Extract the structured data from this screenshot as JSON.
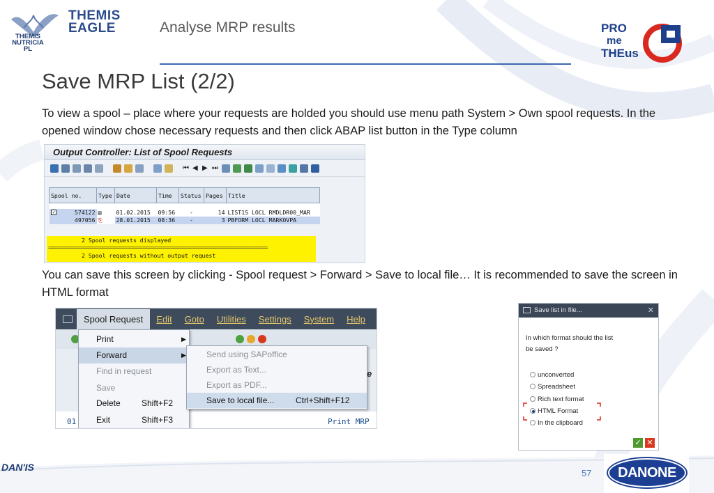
{
  "header": {
    "logo_line1": "THEMIS",
    "logo_line2": "NUTRICIA PL",
    "brand_line1": "THEMIS",
    "brand_line2": "EAGLE",
    "section_title": "Analyse MRP results",
    "prometheus": [
      "PRO",
      "me",
      "THEus"
    ]
  },
  "slide": {
    "title": "Save MRP List (2/2)",
    "paragraph1": "To view a spool – place where your requests are holded you should use menu path System > Own spool requests. In the opened window chose necessary requests and then click ABAP list button in the Type column",
    "paragraph2": "You can save this screen by clicking - Spool request > Forward > Save to local file… It is recommended to save the screen in HTML format"
  },
  "spool_screen": {
    "title": "Output Controller: List of Spool Requests",
    "columns": [
      "Spool no.",
      "Type",
      "Date",
      "Time",
      "Status",
      "Pages",
      "Title"
    ],
    "rows": [
      {
        "spool": "574122",
        "date": "01.02.2015",
        "time": "09:56",
        "status": "-",
        "pages": "14",
        "title": "LIST1S LOCL RMDLDR00_MAR"
      },
      {
        "spool": "497056",
        "date": "28.01.2015",
        "time": "08:36",
        "status": "-",
        "pages": "3",
        "title": "PBFORM LOCL MARKOVPA"
      }
    ],
    "status_line1": "2 Spool requests displayed",
    "status_line2": "2 Spool requests without output request"
  },
  "menu_screen": {
    "menubar": [
      "Spool Request",
      "Edit",
      "Goto",
      "Utilities",
      "Settings",
      "System",
      "Help"
    ],
    "dropdown": [
      {
        "label": "Print",
        "shortcut": "",
        "submenu": true,
        "disabled": false
      },
      {
        "label": "Forward",
        "shortcut": "",
        "submenu": true,
        "disabled": false
      },
      {
        "label": "Find in request",
        "shortcut": "",
        "submenu": false,
        "disabled": true
      },
      {
        "label": "Save",
        "shortcut": "",
        "submenu": false,
        "disabled": true
      },
      {
        "label": "Delete",
        "shortcut": "Shift+F2",
        "submenu": false,
        "disabled": false
      },
      {
        "label": "Exit",
        "shortcut": "Shift+F3",
        "submenu": false,
        "disabled": false
      }
    ],
    "submenu": [
      {
        "label": "Send using SAPoffice",
        "shortcut": "",
        "disabled": true
      },
      {
        "label": "Export as Text...",
        "shortcut": "",
        "disabled": true
      },
      {
        "label": "Export as PDF...",
        "shortcut": "",
        "disabled": true
      },
      {
        "label": "Save to local file...",
        "shortcut": "Ctrl+Shift+F12",
        "disabled": false
      }
    ],
    "bottom_left": "01",
    "bottom_right": "Print MRP"
  },
  "dialog": {
    "title": "Save list in file...",
    "question_line1": "In which format should the list",
    "question_line2": "be saved ?",
    "options": [
      "unconverted",
      "Spreadsheet",
      "Rich text format",
      "HTML Format",
      "In the clipboard"
    ],
    "selected": "HTML Format"
  },
  "footer": {
    "left_logo": "DAN'IS",
    "page_number": "57",
    "right_logo": "DANONE"
  },
  "colors": {
    "accent_blue": "#3b68b0",
    "sap_status_yellow": "#fff200",
    "sap_menubar": "#3d4b5c",
    "danone_blue": "#1c3f94"
  }
}
